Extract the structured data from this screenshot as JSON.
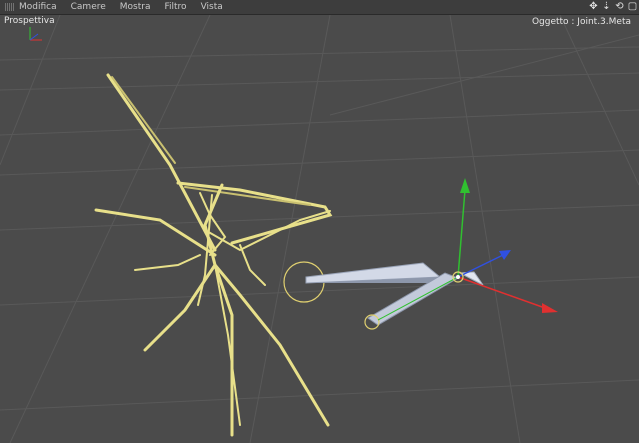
{
  "menubar": {
    "items": [
      {
        "label": "Modifica"
      },
      {
        "label": "Camere"
      },
      {
        "label": "Mostra"
      },
      {
        "label": "Filtro"
      },
      {
        "label": "Vista"
      }
    ],
    "nav_icons": [
      "move-icon",
      "zoom-icon",
      "rotate-icon",
      "maximize-icon"
    ]
  },
  "viewport": {
    "name": "Prospettiva",
    "object_label": "Oggetto : Joint.3.Meta",
    "colors": {
      "background": "#4b4b4b",
      "grid": "#5a5a5a",
      "yellow_geometry": "#e8e08a",
      "axis_x": "#e03030",
      "axis_y": "#30c030",
      "axis_z": "#3050e0",
      "bone": "#cfd6e6"
    }
  }
}
